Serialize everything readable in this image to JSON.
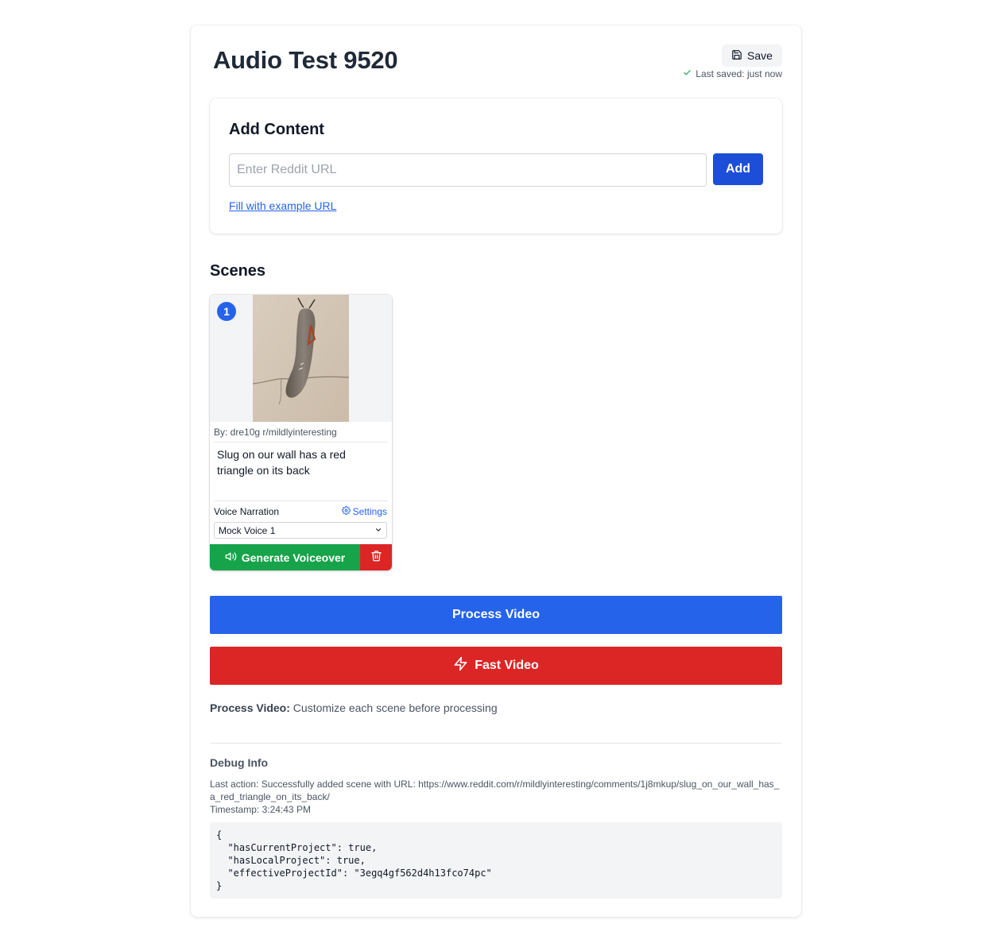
{
  "project": {
    "title": "Audio Test 9520",
    "save_label": "Save",
    "last_saved": "Last saved: just now"
  },
  "add_content": {
    "title": "Add Content",
    "url_placeholder": "Enter Reddit URL",
    "url_value": "",
    "add_label": "Add",
    "example_link": "Fill with example URL"
  },
  "scenes": {
    "title": "Scenes",
    "items": [
      {
        "number": "1",
        "author": "By: dre10g r/mildlyinteresting",
        "text": "Slug on our wall has a red triangle on its back",
        "voice_label": "Voice Narration",
        "settings_label": "Settings",
        "voice_selected": "Mock Voice 1",
        "generate_label": "Generate Voiceover"
      }
    ]
  },
  "actions": {
    "process_label": "Process Video",
    "fast_label": "Fast Video",
    "note_bold": "Process Video:",
    "note_text": " Customize each scene before processing"
  },
  "debug": {
    "title": "Debug Info",
    "last_action": "Last action: Successfully added scene with URL: https://www.reddit.com/r/mildlyinteresting/comments/1j8mkup/slug_on_our_wall_has_a_red_triangle_on_its_back/",
    "timestamp": "Timestamp: 3:24:43 PM",
    "code_lines": [
      "{",
      "  \"hasCurrentProject\": true,",
      "  \"hasLocalProject\": true,",
      "  \"effectiveProjectId\": \"3egq4gf562d4h13fco74pc\"",
      "}"
    ]
  },
  "colors": {
    "primary": "#2563eb",
    "add_button": "#1d4ed8",
    "success": "#16a34a",
    "danger": "#dc2626"
  }
}
